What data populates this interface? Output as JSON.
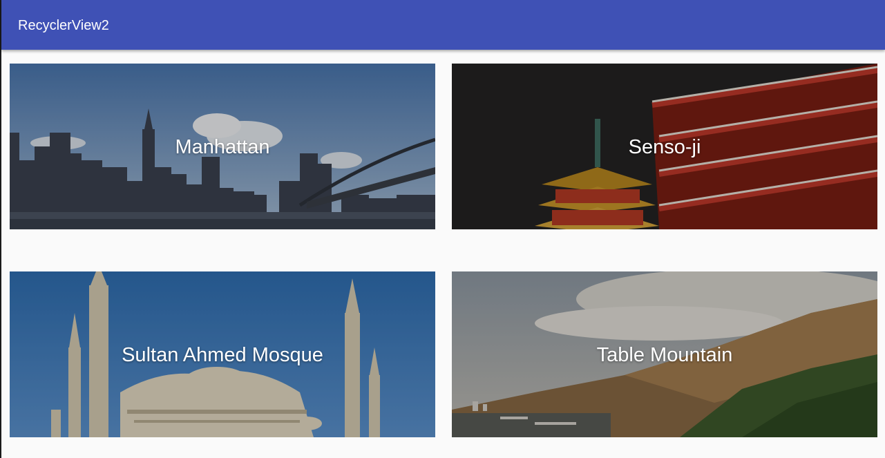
{
  "app_bar": {
    "title": "RecyclerView2",
    "color": "#3f51b5"
  },
  "cards": [
    {
      "title": "Manhattan"
    },
    {
      "title": "Senso-ji"
    },
    {
      "title": "Sultan Ahmed Mosque"
    },
    {
      "title": "Table Mountain"
    }
  ]
}
